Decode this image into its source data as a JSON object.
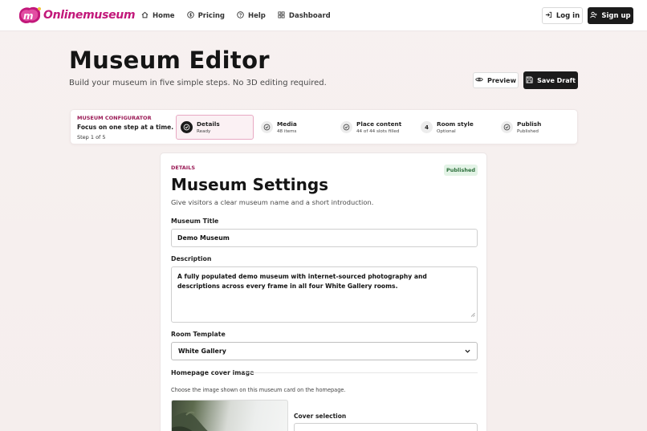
{
  "brand": {
    "name": "Onlinemuseum",
    "color": "#c2187a"
  },
  "nav": [
    {
      "label": "Home",
      "icon": "home-icon"
    },
    {
      "label": "Pricing",
      "icon": "dollar-icon"
    },
    {
      "label": "Help",
      "icon": "help-icon"
    },
    {
      "label": "Dashboard",
      "icon": "dashboard-icon"
    }
  ],
  "auth": {
    "login_label": "Log in",
    "signup_label": "Sign up"
  },
  "header": {
    "title": "Museum Editor",
    "subtitle": "Build your museum in five simple steps. No 3D editing required.",
    "preview_label": "Preview",
    "save_label": "Save Draft"
  },
  "configurator": {
    "label": "MUSEUM CONFIGURATOR",
    "focus": "Focus on one step at a time.",
    "step": "Step 1 of 5",
    "steps": [
      {
        "title": "Details",
        "meta": "Ready",
        "icon": "check-circle-icon",
        "active": true
      },
      {
        "title": "Media",
        "meta": "48 items",
        "icon": "check-circle-icon"
      },
      {
        "title": "Place content",
        "meta": "44 of 44 slots filled",
        "icon": "check-circle-icon"
      },
      {
        "title": "Room style",
        "meta": "Optional",
        "number": "4"
      },
      {
        "title": "Publish",
        "meta": "Published",
        "icon": "check-circle-icon"
      }
    ]
  },
  "details": {
    "section_label": "DETAILS",
    "badge": "Published",
    "title": "Museum Settings",
    "subtitle": "Give visitors a clear museum name and a short introduction.",
    "museum_title_label": "Museum Title",
    "museum_title_value": "Demo Museum",
    "description_label": "Description",
    "description_value": "A fully populated demo museum with internet-sourced photography and descriptions across every frame in all four White Gallery rooms.",
    "room_template_label": "Room Template",
    "room_template_value": "White Gallery",
    "cover_label": "Homepage cover image",
    "cover_help": "Choose the image shown on this museum card on the homepage.",
    "cover_selection_label": "Cover selection"
  },
  "colors": {
    "accent": "#9a1a55",
    "dark": "#1b1b1b",
    "badge_bg": "#e3f3e6",
    "badge_text": "#2c6f3b"
  }
}
